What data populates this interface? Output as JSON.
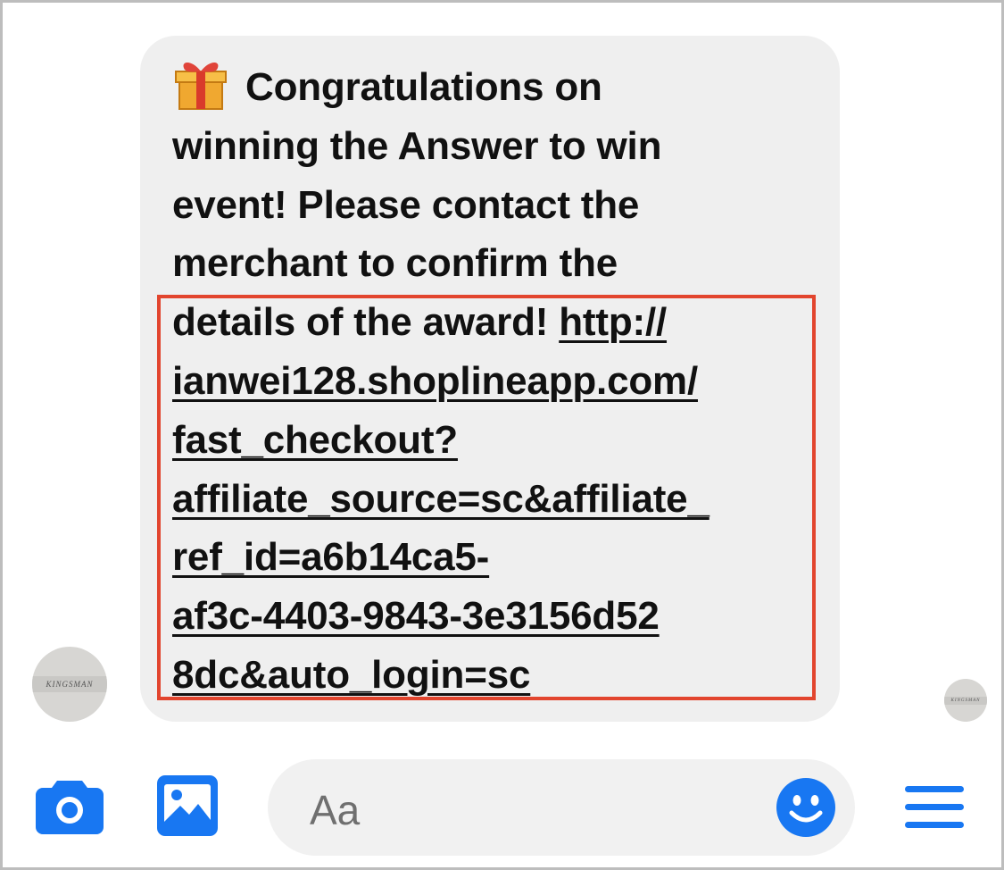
{
  "message": {
    "line1": "Congratulations on",
    "line2": "winning the Answer to win",
    "line3": "event! Please contact the",
    "line4": "merchant to confirm the",
    "line5_text": "details of the award! ",
    "line5_link": "http://",
    "link_lines": [
      "ianwei128.shoplineapp.com/",
      "fast_checkout?",
      "affiliate_source=sc&affiliate_",
      "ref_id=a6b14ca5-",
      "af3c-4403-9843-3e3156d52",
      "8dc&auto_login=sc"
    ],
    "gift_icon": "gift-icon"
  },
  "avatars": {
    "sender_label": "KINGSMAN",
    "reader_label": "KINGSMAN"
  },
  "composer": {
    "placeholder": "Aa",
    "camera_icon": "camera-icon",
    "image_icon": "image-icon",
    "emoji_icon": "smile-emoji-icon",
    "menu_icon": "menu-icon"
  },
  "colors": {
    "accent": "#1877f2",
    "highlight": "#e2452e",
    "bubble": "#efefef"
  }
}
